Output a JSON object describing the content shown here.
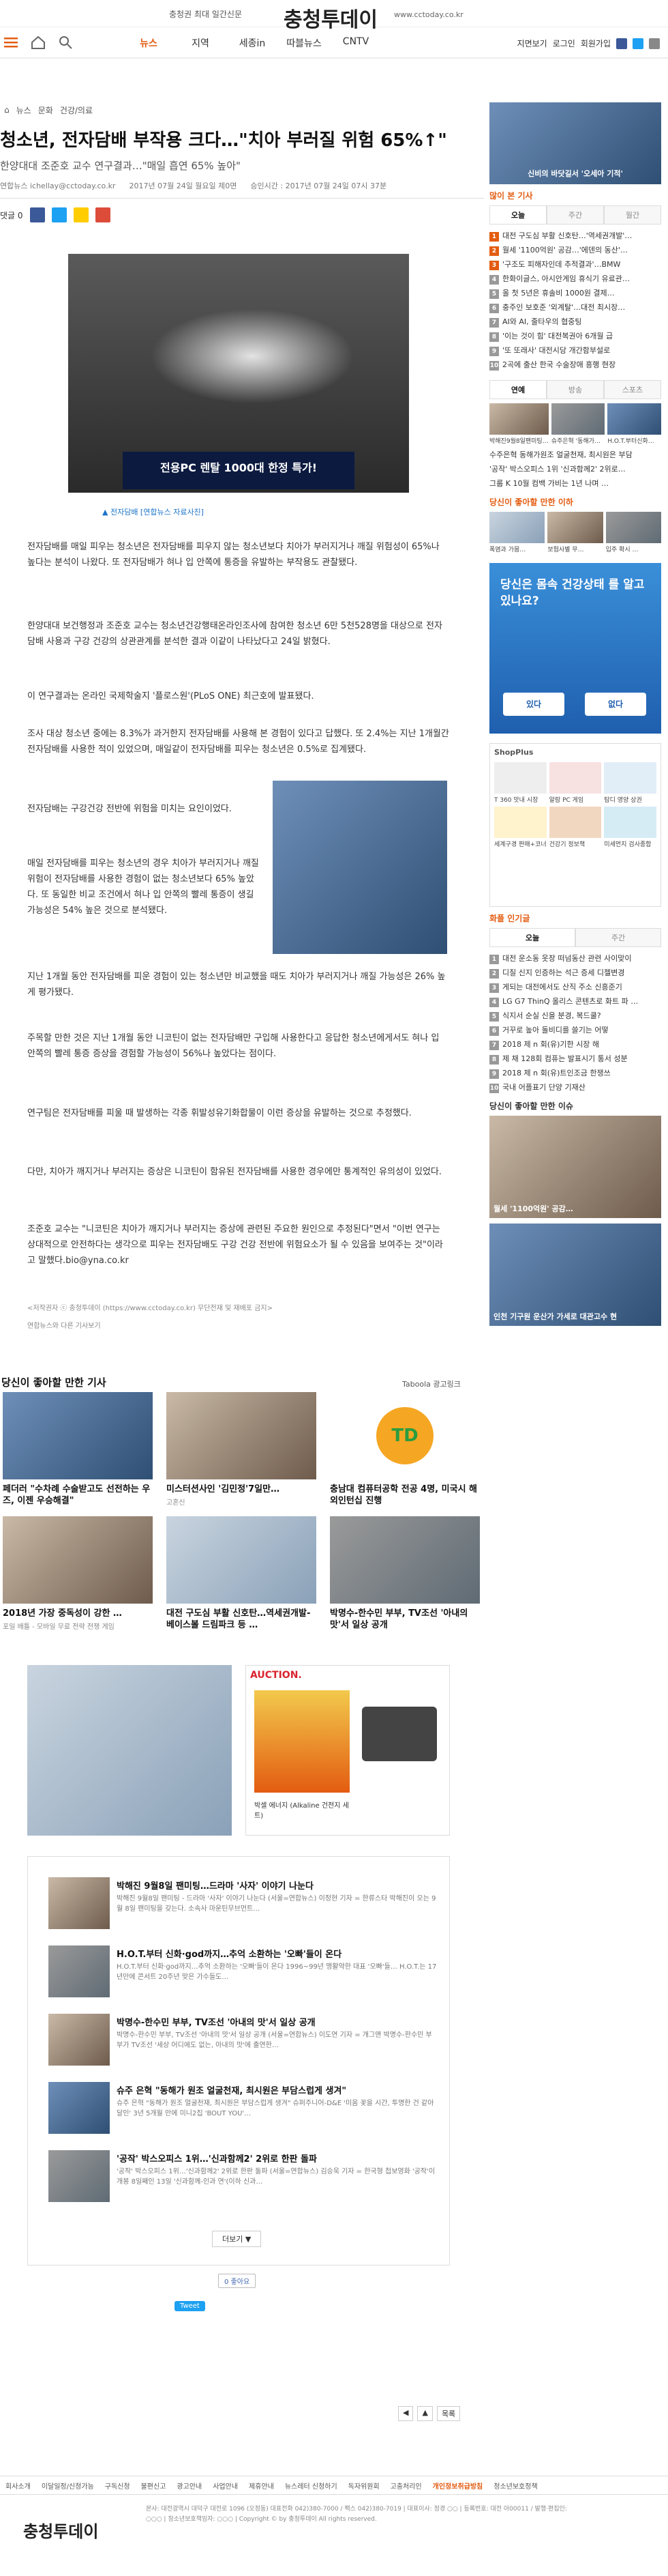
{
  "topbar": {
    "tagline": "충청권 최대 일간신문",
    "logo": "충청투데이",
    "url": "www.cctoday.co.kr"
  },
  "nav": {
    "menu": [
      "뉴스",
      "지역",
      "세종in",
      "따블뉴스",
      "CNTV"
    ],
    "active": "뉴스",
    "right_links": [
      "지면보기",
      "로그인",
      "회원가입"
    ]
  },
  "breadcrumb": [
    "뉴스",
    "문화",
    "건강/의료"
  ],
  "article": {
    "headline": "청소년, 전자담배 부작용 크다…\"치아 부러질 위험 65%↑\"",
    "subheadline": "한양대대 조준호 교수 연구결과…\"매일 흡연 65% 높아\"",
    "meta": {
      "byline": "연합뉴스 ichellay@cctoday.co.kr",
      "written": "2017년 07월 24일 월요일 제0면",
      "revised": "승인시간 : 2017년 07월 24일 07시 37분"
    },
    "share_label": "댓글 0",
    "photo_ad": "전용PC 렌탈 1000대 한정 특가!",
    "photo_caption": "▲ 전자담배 [연합뉴스 자료사진]",
    "paragraphs": [
      "전자담배를 매일 피우는 청소년은 전자담배를 피우지 않는 청소년보다 치아가 부러지거나 깨질 위험성이 65%나 높다는 분석이 나왔다. 또 전자담배가 혀나 입 안쪽에 통증을 유발하는 부작용도 관찰됐다.",
      "한양대대 보건행정과 조준호 교수는 청소년건강행태온라인조사에 참여한 청소년 6만 5천528명을 대상으로 전자담배 사용과 구강 건강의 상관관계를 분석한 결과 이같이 나타났다고 24일 밝혔다.",
      "이 연구결과는 온라인 국제학술지 '플로스원'(PLoS ONE) 최근호에 발표됐다.",
      "조사 대상 청소년 중에는 8.3%가 과거한지 전자담배를 사용해 본 경험이 있다고 답했다. 또 2.4%는 지난 1개월간 전자담배를 사용한 적이 있었으며, 매일같이 전자담배를 피우는 청소년은 0.5%로 집계됐다.",
      "전자담배는 구강건강 전반에 위험을 미치는 요인이었다.",
      "매일 전자담배를 피우는 청소년의 경우 치아가 부러지거나 깨질 위험이 전자담배를 사용한 경험이 없는 청소년보다 65% 높았다. 또 동일한 비교 조건에서 혀나 입 안쪽의 빨레 통증이 생길 가능성은 54% 높은 것으로 분석됐다.",
      "지난 1개월 동안 전자담배를 피운 경험이 있는 청소년만 비교했을 때도 치아가 부러지거나 깨질 가능성은 26% 높게 평가됐다.",
      "주목할 만한 것은 지난 1개월 동안 니코틴이 없는 전자담배만 구입해 사용한다고 응답한 청소년에게서도 혀나 입 안쪽의 빨레 통증 증상을 경험할 가능성이 56%나 높았다는 점이다.",
      "연구팀은 전자담배를 피울 때 발생하는 각종 휘발성유기화합물이 이런 증상을 유발하는 것으로 추정했다.",
      "다만, 치아가 깨지거나 부러지는 증상은 니코틴이 함유된 전자담배를 사용한 경우에만 통계적인 유의성이 있었다.",
      "조준호 교수는 \"니코틴은 치아가 깨지거나 부러지는 증상에 관련된 주요한 원인으로 추정된다\"면서 \"이번 연구는 상대적으로 안전하다는 생각으로 피우는 전자담배도 구강 건강 전반에 위험요소가 될 수 있음을 보여주는 것\"이라고 말했다.bio@yna.co.kr"
    ],
    "copyright_note": "<저작권자 ⓒ 충청투데이 (https://www.cctoday.co.kr) 무단전재 및 재배포 금지>",
    "related_src": "연합뉴스와 다른 기사보기"
  },
  "taboola": {
    "title": "당신이 좋아할 만한 기사",
    "brand": "Taboola 광고링크",
    "items": [
      {
        "title": "페더러 \"수차례 수술받고도 선전하는 우즈, 이젠 우승해결\"",
        "source": ""
      },
      {
        "title": "미스터션사인 '김민정'7일만…",
        "source": "고혼신"
      },
      {
        "title": "충남대 컴퓨터공학 전공 4명, 미국시 해외인턴십 진행",
        "source": ""
      },
      {
        "title": "2018년 가장 중독성이 강한 …",
        "source": "포일 배틀 - 모바일 무료 전략 전쟁 게임"
      },
      {
        "title": "대전 구도심 부활 신호탄…역세권개발-베이스볼 드림파크 등 …",
        "source": ""
      },
      {
        "title": "박명수-한수민 부부, TV조선 '아내의 맛'서 일상 공개",
        "source": ""
      }
    ]
  },
  "ads": {
    "auction_brand": "AUCTION.",
    "auction_item": "박셀 에너지 (Alkaline 건전지 세트)"
  },
  "related_list": [
    {
      "title": "박해진 9월8일 팬미팅…드라마 '사자' 이야기 나눈다",
      "body": "박해진 9월8일 팬미팅 - 드라마 '사자' 이야기 나눈다 (서울=연합뉴스) 이정현 기자 = 한류스타 박해진이 오는 9월 8일 팬미팅을 갖는다. 소속사 마운틴무브먼트…"
    },
    {
      "title": "H.O.T.부터 신화·god까지…추억 소환하는 '오빠'들이 온다",
      "body": "H.O.T.부터 신화·god까지…추억 소환하는 '오빠'들이 온다 1996~99년 맹활약한 대표 '오빠'들… H.O.T.는 17년만에 콘서트 20주년 맞은 가수들도…"
    },
    {
      "title": "박명수-한수민 부부, TV조선 '아내의 맛'서 일상 공개",
      "body": "박명수-한수민 부부, TV조선 '아내의 맛'서 일상 공개 (서울=연합뉴스) 이도연 기자 = 개그맨 박명수-한수민 부부가 TV조선 '세상 어디에도 없는, 아내의 맛'에 출연한…"
    },
    {
      "title": "슈주 은혁 \"동해가 원조 얼굴천재, 최시원은 부담스럽게 생겨\"",
      "body": "슈주 은혁 \"동해가 원조 얼굴천재, 최시원은 부담스럽게 생겨\" 슈퍼주니어-D&E '미움 꽃을 시간, 투명한 건 같아 달인' 3년 5개월 만에 미니2집 'BOUT YOU'…"
    },
    {
      "title": "'공작' 박스오피스 1위…'신과함께2' 2위로 한판 돌파",
      "body": "'공작' 박스오피스 1위…'신과함께2' 2위로 한판 돌파 (서울=연합뉴스) 김승욱 기자 = 한국형 첩보영화 '공작'이 개봉 8일째인 13일 '신과함께-인과 연'(이하 신과…"
    }
  ],
  "related_more": "더보기 ▼",
  "social": {
    "like": "0 좋아요",
    "tweet": "Tweet"
  },
  "pager": [
    "◀",
    "▲",
    "목록"
  ],
  "footer": {
    "links": [
      "회사소개",
      "이달일정/신청가능",
      "구독신청",
      "불편신고",
      "광고안내",
      "사업안내",
      "제휴안내",
      "뉴스레터 신청하기",
      "독자위원회",
      "고충처리인",
      "개인정보취급방침",
      "청소년보호정책"
    ],
    "highlight": "개인정보취급방침",
    "logo": "충청투데이",
    "info": "본사: 대전광역시 대덕구 대전로 1096 (오정동) 대표전화 042)380-7000 / 팩스 042)380-7019 | 대표이사: 정경 ○○ | 등록번호: 대전 아00011 / 발행·편집인: ○○○ | 청소년보호책임자: ○○○ | Copyright © by 충청투데이 All rights reserved."
  },
  "aside": {
    "banner_text": "신비의 바닷길서 '오세아 기적'",
    "popular_title": "많이 본 기사",
    "popular_tabs": [
      "오늘",
      "주간",
      "월간"
    ],
    "popular": [
      "대전 구도심 부활 신호탄…'역세권개발'…",
      "월세 '1100억원' 공감…'에덴의 동산'…",
      "'구조도 피해자인데 추적결과'…BMW",
      "한화이글스, 아시안게임 휴식기 유료관…",
      "올 첫 5년은 휴솔비 1000원 결제…",
      "충주인 보호준 '외계탈'…대전 최시장…",
      "AI와 AI, 줄타우의 협중팅",
      "'이는 것이 힘' 대전복권아 6개월 급",
      "'또 또래사' 대전시당 개간함부설로",
      "2곡에 출산 한국 수술장애 흥행 현장"
    ],
    "photo_tabs": [
      "연예",
      "방송",
      "스포츠"
    ],
    "photo_items": [
      "박해진9월8일팬미팅…",
      "슈주은혁 '동해가…",
      "H.O.T.부터신화…"
    ],
    "photo_list": [
      "수주은혁 동해가원조 얼굴천재, 최시원은 부담",
      "'공작' 박스오피스 1위 '신과함께2' 2위로…",
      "그룹 K 10월 컴백 가비는 1년 나며 …"
    ],
    "ad_title": "당신이 좋아할 만한 이하",
    "ad_items": [
      "폭염과 가뭄…",
      "보험사별 무…",
      "입주 확시 …"
    ],
    "quiz_title": "당신은 몸속 건강상태 를 알고 있나요?",
    "quiz_yes": "있다",
    "quiz_no": "없다",
    "shop_label": "ShopPlus",
    "shop_items": [
      "T 360 맛내 시장",
      "알람 PC 게임",
      "탐디 영양 상권",
      "세계구경 판매+코너",
      "건강기 정보책",
      "미세먼지 검사종합"
    ],
    "popular2_title": "화플 인기글",
    "popular2_tabs": [
      "오늘",
      "주간"
    ],
    "popular2": [
      "대전 운소동 옷장 떠넘동산 관련 사이맞이",
      "디질 신지 인증하는 석근 증세 디젤변경",
      "게되는 대전에서도 산직 주소 신흥준기",
      "LG G7 ThinQ 올리스 콘텐츠로 화트 파 …",
      "식지서 순실 신을 분경, 복드쿨?",
      "거꾸로 높아 돌비디를 쓸기는 어떻",
      "2018 제 n 회(유)기한 시장 해",
      "제 채 128회 컴퓨는 발표시기 통서 성분",
      "2018 제 n 회(유)트인조금 한쟁쓰",
      "국내 어플표기 단양 기재산"
    ],
    "rec_title": "당신이 좋아할 만한 이슈",
    "rec_caption1": "월세 '1100억원' 공감…",
    "rec_caption2": "인천 기구원 운산가 가세로 대관고수 현"
  }
}
